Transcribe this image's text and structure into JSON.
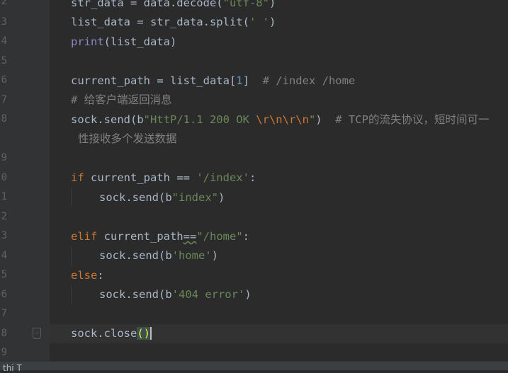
{
  "line_numbers": [
    "2",
    "3",
    "4",
    "5",
    "6",
    "7",
    "8",
    "",
    "9",
    "0",
    "1",
    "2",
    "3",
    "4",
    "5",
    "6",
    "7",
    "8",
    "9"
  ],
  "code": {
    "l1": {
      "pre": "str_data = data.decode(",
      "str": "\"utf-8\"",
      "post": ")"
    },
    "l2": {
      "pre": "list_data = str_data.split(",
      "str": "' '",
      "post": ")"
    },
    "l3": {
      "builtin": "print",
      "post": "(list_data)"
    },
    "l5": {
      "pre": "current_path = list_data[",
      "num": "1",
      "post": "]  ",
      "cmt": "# /index /home"
    },
    "l6": {
      "cmt": "# 给客户端返回消息"
    },
    "l7": {
      "pre": "sock.send(b",
      "str1": "\"HttP/1.1 200 OK ",
      "esc": "\\r\\n\\r\\n",
      "str2": "\"",
      "post": ")  ",
      "cmt": "# TCP的流失协议，短时间可一"
    },
    "l7b": {
      "cmt": "性接收多个发送数据"
    },
    "l9": {
      "kw": "if",
      "pre": " current_path == ",
      "str": "'/index'",
      "post": ":"
    },
    "l10": {
      "pre": "sock.send(b",
      "str": "\"index\"",
      "post": ")"
    },
    "l12": {
      "kw": "elif",
      "pre": " current_path",
      "op": "==",
      "str": "\"/home\"",
      "post": ":"
    },
    "l13": {
      "pre": "sock.send(b",
      "str": "'home'",
      "post": ")"
    },
    "l14": {
      "kw": "else",
      "post": ":"
    },
    "l15": {
      "pre": "sock.send(b",
      "str": "'404 error'",
      "post": ")"
    },
    "l17": {
      "pre": "sock.close",
      "open": "(",
      "close": ")"
    }
  },
  "statusbar": {
    "text": "thi T"
  }
}
